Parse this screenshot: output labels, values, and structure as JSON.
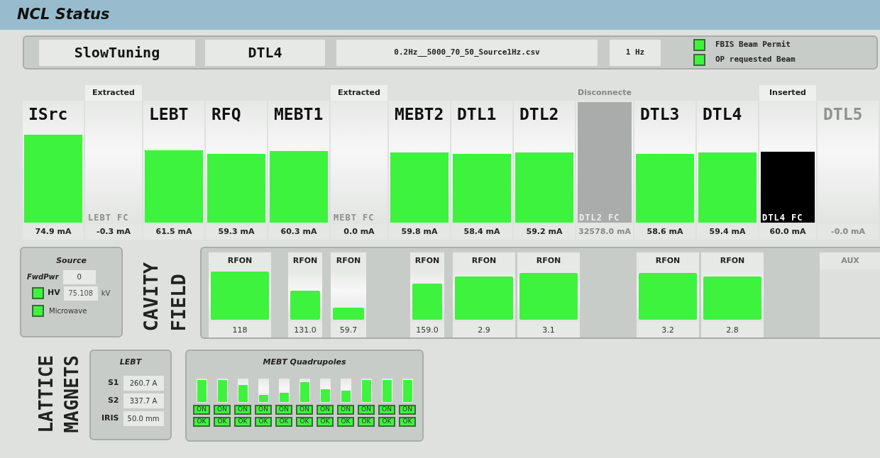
{
  "title": "NCL Status",
  "header": {
    "mode": "SlowTuning",
    "target": "DTL4",
    "file": "0.2Hz__5000_70_50_Source1Hz.csv",
    "rate": "1 Hz",
    "indicators": [
      {
        "label": "FBIS Beam Permit",
        "on": true
      },
      {
        "label": "OP requested Beam",
        "on": true
      }
    ]
  },
  "beamline": [
    {
      "kind": "section",
      "name": "ISrc",
      "level": 0.74,
      "reading": "74.9 mA",
      "disabled": false
    },
    {
      "kind": "fc",
      "status": "Extracted",
      "label": "LEBT FC",
      "inserted": false,
      "disconnected": false,
      "reading": "-0.3 mA"
    },
    {
      "kind": "section",
      "name": "LEBT",
      "level": 0.61,
      "reading": "61.5 mA",
      "disabled": false
    },
    {
      "kind": "section",
      "name": "RFQ",
      "level": 0.58,
      "reading": "59.3 mA",
      "disabled": false
    },
    {
      "kind": "section",
      "name": "MEBT1",
      "level": 0.6,
      "reading": "60.3 mA",
      "disabled": false
    },
    {
      "kind": "fc",
      "status": "Extracted",
      "label": "MEBT FC",
      "inserted": false,
      "disconnected": false,
      "reading": "0.0 mA"
    },
    {
      "kind": "section",
      "name": "MEBT2",
      "level": 0.59,
      "reading": "59.8 mA",
      "disabled": false
    },
    {
      "kind": "section",
      "name": "DTL1",
      "level": 0.58,
      "reading": "58.4 mA",
      "disabled": false
    },
    {
      "kind": "section",
      "name": "DTL2",
      "level": 0.59,
      "reading": "59.2 mA",
      "disabled": false
    },
    {
      "kind": "fc",
      "status": "Disconnecte",
      "label": "DTL2 FC",
      "disconnected": true,
      "level": 1,
      "reading": "32578.0 mA"
    },
    {
      "kind": "section",
      "name": "DTL3",
      "level": 0.58,
      "reading": "58.6 mA",
      "disabled": false
    },
    {
      "kind": "section",
      "name": "DTL4",
      "level": 0.59,
      "reading": "59.4 mA",
      "disabled": false
    },
    {
      "kind": "fc",
      "status": "Inserted",
      "label": "DTL4 FC",
      "inserted": true,
      "disconnected": false,
      "level": 0.59,
      "reading": "60.0 mA"
    },
    {
      "kind": "section",
      "name": "DTL5",
      "reading": "-0.0 mA",
      "disabled": true
    }
  ],
  "source": {
    "title": "Source",
    "fwd_pwr": {
      "label": "FwdPwr",
      "value": "0"
    },
    "hv": {
      "label": "HV",
      "on": true,
      "value": "75.108",
      "unit": "kV"
    },
    "microwave": {
      "label": "Microwave",
      "on": true
    }
  },
  "cavity_label": [
    "CAVITY",
    "FIELD"
  ],
  "cavities": [
    {
      "kind": "cavity",
      "status": "RFON",
      "level": 1,
      "reading": "118"
    },
    {
      "kind": "cavity",
      "status": "RFON",
      "level": 0.6,
      "reading": "131.0"
    },
    {
      "kind": "cavity",
      "status": "RFON",
      "level": 0.25,
      "reading": "59.7"
    },
    {
      "kind": "cavity",
      "status": "RFON",
      "level": 0.75,
      "reading": "159.0"
    },
    {
      "kind": "cavity",
      "status": "RFON",
      "level": 0.9,
      "reading": "2.9"
    },
    {
      "kind": "cavity",
      "status": "RFON",
      "level": 0.97,
      "reading": "3.1"
    },
    {
      "kind": "cavity",
      "status": "RFON",
      "level": 0.97,
      "reading": "3.2"
    },
    {
      "kind": "cavity",
      "status": "RFON",
      "level": 0.9,
      "reading": "2.8"
    },
    {
      "kind": "aux",
      "status": "AUX"
    }
  ],
  "lattice_label": [
    "LATTICE",
    "MAGNETS"
  ],
  "lebt": {
    "title": "LEBT",
    "rows": [
      {
        "label": "S1",
        "value": "260.7 A"
      },
      {
        "label": "S2",
        "value": "337.7 A"
      },
      {
        "label": "IRIS",
        "value": "50.0 mm"
      }
    ]
  },
  "mebt_quads": {
    "title": "MEBT Quadrupoles",
    "items": [
      {
        "level": 1,
        "on_label": "ON",
        "on": true,
        "ok_label": "OK",
        "ok": true
      },
      {
        "level": 1,
        "on_label": "ON",
        "on": true,
        "ok_label": "OK",
        "ok": true
      },
      {
        "level": 0.75,
        "on_label": "ON",
        "on": true,
        "ok_label": "OK",
        "ok": true
      },
      {
        "level": 0.3,
        "on_label": "ON",
        "on": true,
        "ok_label": "OK",
        "ok": true
      },
      {
        "level": 0.4,
        "on_label": "ON",
        "on": true,
        "ok_label": "OK",
        "ok": true
      },
      {
        "level": 0.9,
        "on_label": "ON",
        "on": true,
        "ok_label": "OK",
        "ok": true
      },
      {
        "level": 0.55,
        "on_label": "ON",
        "on": true,
        "ok_label": "OK",
        "ok": true
      },
      {
        "level": 0.5,
        "on_label": "ON",
        "on": true,
        "ok_label": "OK",
        "ok": true
      },
      {
        "level": 1,
        "on_label": "ON",
        "on": true,
        "ok_label": "OK",
        "ok": true
      },
      {
        "level": 1,
        "on_label": "ON",
        "on": true,
        "ok_label": "OK",
        "ok": true
      },
      {
        "level": 1,
        "on_label": "ON",
        "on": true,
        "ok_label": "OK",
        "ok": true
      }
    ]
  }
}
